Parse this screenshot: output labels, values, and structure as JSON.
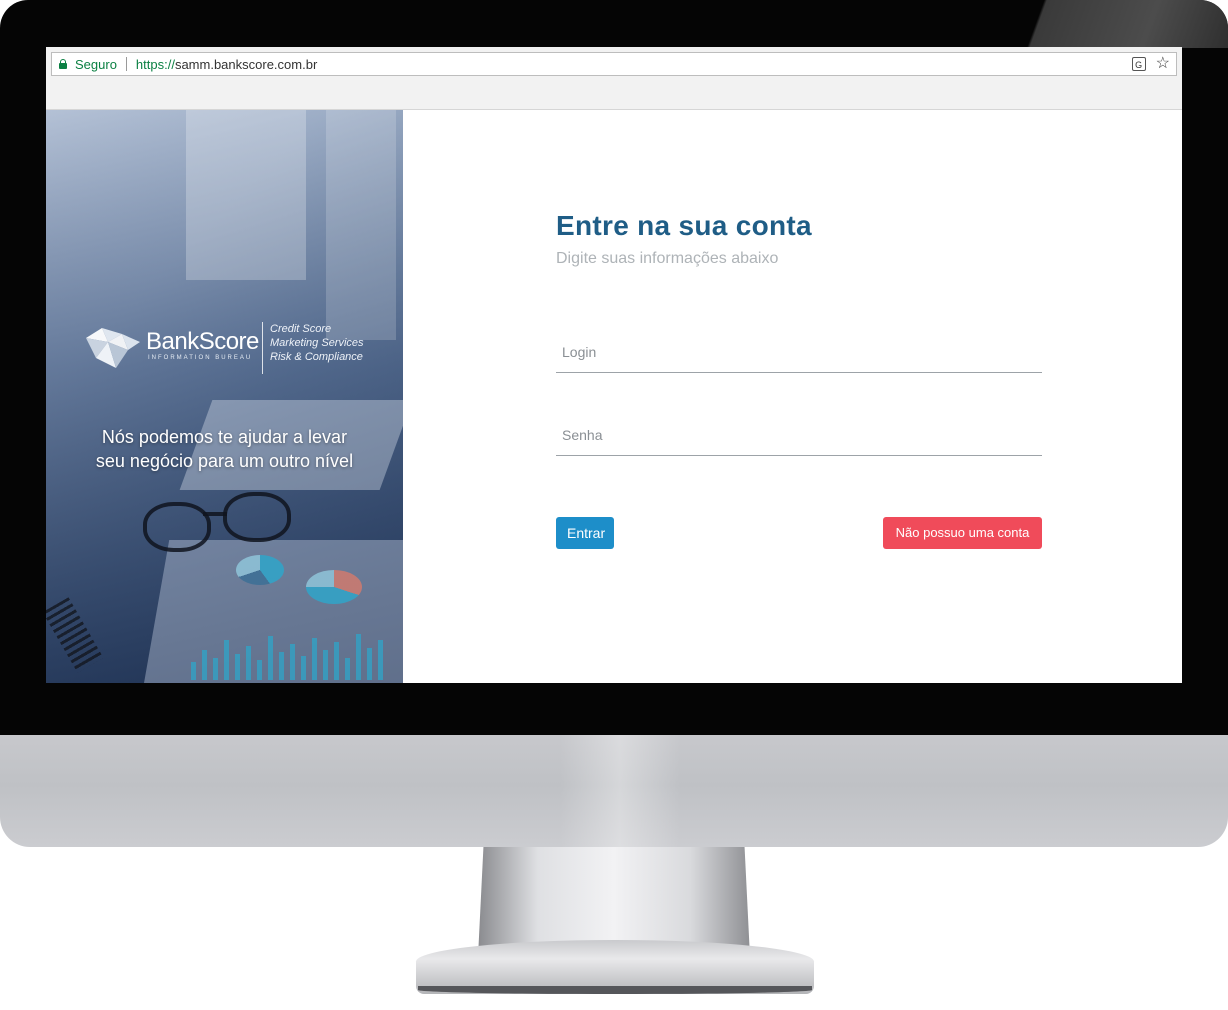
{
  "browser": {
    "secure_label": "Seguro",
    "url_scheme": "https://",
    "url_host": "samm.bankscore.com.br",
    "icons": [
      "lock-icon",
      "translate-icon",
      "bookmark-star-icon"
    ]
  },
  "brand": {
    "name": "BankScore",
    "subname": "INFORMATION BUREAU",
    "tags": [
      "Credit Score",
      "Marketing Services",
      "Risk & Compliance"
    ]
  },
  "hero": {
    "line1": "Nós podemos te ajudar a levar",
    "line2": "seu negócio para um outro nível"
  },
  "login": {
    "title": "Entre na sua conta",
    "subtitle": "Digite suas informações abaixo",
    "login_placeholder": "Login",
    "login_value": "",
    "password_placeholder": "Senha",
    "password_value": "",
    "submit_label": "Entrar",
    "register_label": "Não possuo uma conta"
  },
  "colors": {
    "title": "#1f5d86",
    "submit_button": "#1d8ec9",
    "register_button": "#f04b5a",
    "secure": "#0b8043"
  }
}
